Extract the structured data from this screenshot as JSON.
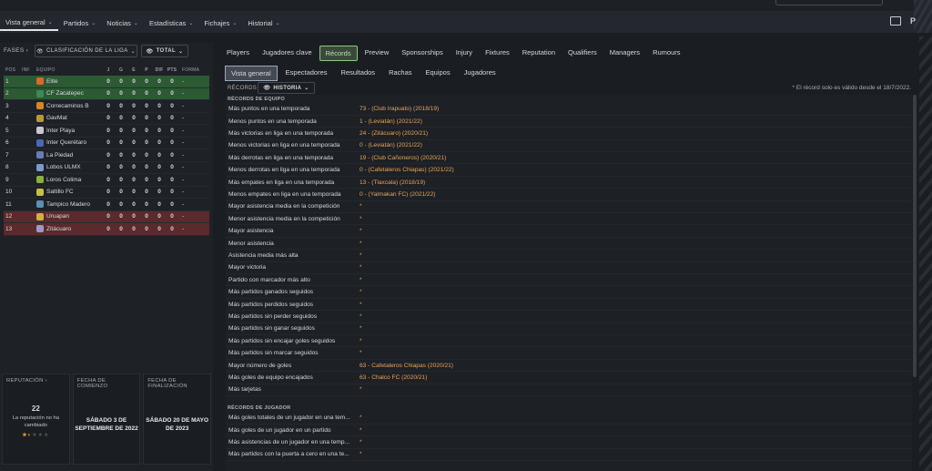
{
  "nav": {
    "items": [
      {
        "label": "Vista general",
        "active": true
      },
      {
        "label": "Partidos"
      },
      {
        "label": "Noticias"
      },
      {
        "label": "Estadísticas"
      },
      {
        "label": "Fichajes"
      },
      {
        "label": "Historial"
      }
    ]
  },
  "left": {
    "phases_label": "FASES",
    "classification_label": "CLASIFICACIÓN DE LA LIGA",
    "total_label": "TOTAL",
    "headers": [
      "POS",
      "INF",
      "EQUIPO",
      "J",
      "G",
      "E",
      "P",
      "DIF",
      "PTS",
      "FORMA"
    ],
    "rows": [
      {
        "pos": "1",
        "team": "Elite",
        "j": "0",
        "g": "0",
        "e": "0",
        "p": "0",
        "dif": "0",
        "pts": "0",
        "forma": "-",
        "zone": "green",
        "crest": "#d86a2a"
      },
      {
        "pos": "2",
        "team": "CF Zacatepec",
        "j": "0",
        "g": "0",
        "e": "0",
        "p": "0",
        "dif": "0",
        "pts": "0",
        "forma": "-",
        "zone": "green",
        "crest": "#3a8a5a"
      },
      {
        "pos": "3",
        "team": "Correcaminos B",
        "j": "0",
        "g": "0",
        "e": "0",
        "p": "0",
        "dif": "0",
        "pts": "0",
        "forma": "-",
        "zone": "",
        "crest": "#d8852a"
      },
      {
        "pos": "4",
        "team": "GavMat",
        "j": "0",
        "g": "0",
        "e": "0",
        "p": "0",
        "dif": "0",
        "pts": "0",
        "forma": "-",
        "zone": "",
        "crest": "#b89a30"
      },
      {
        "pos": "5",
        "team": "Inter Playa",
        "j": "0",
        "g": "0",
        "e": "0",
        "p": "0",
        "dif": "0",
        "pts": "0",
        "forma": "-",
        "zone": "",
        "crest": "#c8c8d0"
      },
      {
        "pos": "6",
        "team": "Inter Querétaro",
        "j": "0",
        "g": "0",
        "e": "0",
        "p": "0",
        "dif": "0",
        "pts": "0",
        "forma": "-",
        "zone": "",
        "crest": "#4a6ab0"
      },
      {
        "pos": "7",
        "team": "La Piedad",
        "j": "0",
        "g": "0",
        "e": "0",
        "p": "0",
        "dif": "0",
        "pts": "0",
        "forma": "-",
        "zone": "",
        "crest": "#6a7ab8"
      },
      {
        "pos": "8",
        "team": "Lobos ULMX",
        "j": "0",
        "g": "0",
        "e": "0",
        "p": "0",
        "dif": "0",
        "pts": "0",
        "forma": "-",
        "zone": "",
        "crest": "#7a9ad0"
      },
      {
        "pos": "9",
        "team": "Loros Colima",
        "j": "0",
        "g": "0",
        "e": "0",
        "p": "0",
        "dif": "0",
        "pts": "0",
        "forma": "-",
        "zone": "",
        "crest": "#8ab040"
      },
      {
        "pos": "10",
        "team": "Saltillo FC",
        "j": "0",
        "g": "0",
        "e": "0",
        "p": "0",
        "dif": "0",
        "pts": "0",
        "forma": "-",
        "zone": "",
        "crest": "#c8c040"
      },
      {
        "pos": "11",
        "team": "Tampico Madero",
        "j": "0",
        "g": "0",
        "e": "0",
        "p": "0",
        "dif": "0",
        "pts": "0",
        "forma": "-",
        "zone": "",
        "crest": "#5a90b0"
      },
      {
        "pos": "12",
        "team": "Uruapan",
        "j": "0",
        "g": "0",
        "e": "0",
        "p": "0",
        "dif": "0",
        "pts": "0",
        "forma": "-",
        "zone": "red",
        "crest": "#d0b040"
      },
      {
        "pos": "13",
        "team": "Zitácuaro",
        "j": "0",
        "g": "0",
        "e": "0",
        "p": "0",
        "dif": "0",
        "pts": "0",
        "forma": "-",
        "zone": "red",
        "crest": "#9a9ac8"
      }
    ],
    "cards": {
      "reputation": {
        "title": "REPUTACIÓN",
        "value": "22",
        "text": "La reputación no ha cambiado"
      },
      "start": {
        "title": "FECHA DE COMIENZO",
        "value": "SÁBADO 3 DE SEPTIEMBRE DE 2022"
      },
      "end": {
        "title": "FECHA DE FINALIZACIÓN",
        "value": "SÁBADO 20 DE MAYO DE 2023"
      }
    }
  },
  "tabs": [
    "Players",
    "Jugadores clave",
    "Récords",
    "Preview",
    "Sponsorships",
    "Injury",
    "Fixtures",
    "Reputation",
    "Qualifiers",
    "Managers",
    "Rumours"
  ],
  "subtabs": [
    "Vista general",
    "Espectadores",
    "Resultados",
    "Rachas",
    "Equipos",
    "Jugadores"
  ],
  "records": {
    "label": "RÉCORDS",
    "historia_label": "HISTORIA",
    "note": "* El récord solo es válido desde el 18/7/2022.",
    "team_header": "RÉCORDS DE EQUIPO",
    "team": [
      {
        "label": "Más puntos en una temporada",
        "value": "73 - (Club Irapuato) (2018/19)"
      },
      {
        "label": "Menos puntos en una temporada",
        "value": "1 - (Leviatán) (2021/22)"
      },
      {
        "label": "Más victorias en liga en una temporada",
        "value": "24 - (Zitácuaro) (2020/21)"
      },
      {
        "label": "Menos victorias en liga en una temporada",
        "value": "0 - (Leviatán) (2021/22)"
      },
      {
        "label": "Más derrotas en liga en una temporada",
        "value": "19 - (Club Cañoneros) (2020/21)"
      },
      {
        "label": "Menos derrotas en liga en una temporada",
        "value": "0 - (Cafetaleros Chiapas) (2021/22)"
      },
      {
        "label": "Más empates en liga en una temporada",
        "value": "13 - (Tlaxcala) (2018/19)"
      },
      {
        "label": "Menos empates en liga en una temporada",
        "value": "0 - (Yalmakan FC) (2021/22)"
      },
      {
        "label": "Mayor asistencia media en la competición",
        "value": "*"
      },
      {
        "label": "Menor asistencia media en la competición",
        "value": "*"
      },
      {
        "label": "Mayor asistencia",
        "value": "*"
      },
      {
        "label": "Menor asistencia",
        "value": "*"
      },
      {
        "label": "Asistencia media más alta",
        "value": "*"
      },
      {
        "label": "Mayor victoria",
        "value": "*"
      },
      {
        "label": "Partido con marcador más alto",
        "value": "*"
      },
      {
        "label": "Más partidos ganados seguidos",
        "value": "*"
      },
      {
        "label": "Más partidos perdidos seguidos",
        "value": "*"
      },
      {
        "label": "Más partidos sin perder seguidos",
        "value": "*"
      },
      {
        "label": "Más partidos sin ganar seguidos",
        "value": "*"
      },
      {
        "label": "Más partidos sin encajar goles seguidos",
        "value": "*"
      },
      {
        "label": "Más partidos sin marcar seguidos",
        "value": "*"
      },
      {
        "label": "Mayor número de goles",
        "value": "63 - Cafetaleros Chiapas (2020/21)"
      },
      {
        "label": "Más goles de equipo encajados",
        "value": "63 - Chalco FC (2020/21)"
      },
      {
        "label": "Más tarjetas",
        "value": "*"
      }
    ],
    "player_header": "RÉCORDS DE JUGADOR",
    "player": [
      {
        "label": "Más goles totales de un jugador en una tem...",
        "value": "*"
      },
      {
        "label": "Más goles de un jugador en un partido",
        "value": "*"
      },
      {
        "label": "Más asistencias de un jugador en una temp...",
        "value": "*"
      },
      {
        "label": "Más partidos con la puerta a cero en una te...",
        "value": "*"
      }
    ]
  }
}
